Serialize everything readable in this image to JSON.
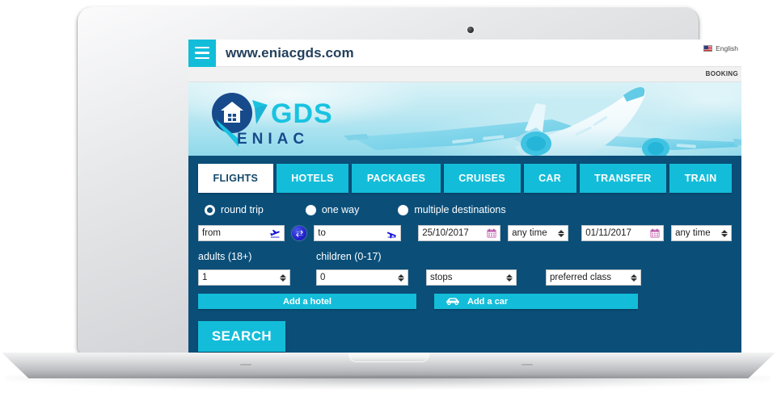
{
  "browser": {
    "menu_icon": "hamburger-icon",
    "url": "www.eniacgds.com",
    "language": "English",
    "language_flag_icon": "us-flag-icon",
    "booking_label": "BOOKING"
  },
  "hero": {
    "logo_primary": "GDS",
    "logo_secondary": "E N I A C",
    "logo_icon": "house-in-circle-icon",
    "plane_icon": "airplane-photo"
  },
  "tabs": [
    {
      "label": "FLIGHTS",
      "active": true
    },
    {
      "label": "HOTELS",
      "active": false
    },
    {
      "label": "PACKAGES",
      "active": false
    },
    {
      "label": "CRUISES",
      "active": false
    },
    {
      "label": "CAR",
      "active": false
    },
    {
      "label": "TRANSFER",
      "active": false
    },
    {
      "label": "TRAIN",
      "active": false
    }
  ],
  "trip_types": [
    {
      "label": "round trip",
      "selected": true
    },
    {
      "label": "one way",
      "selected": false
    },
    {
      "label": "multiple destinations",
      "selected": false
    }
  ],
  "search_form": {
    "origin": {
      "value": "from",
      "icon": "plane-departure-icon"
    },
    "swap": {
      "icon": "swap-arrows-icon"
    },
    "destination": {
      "value": "to",
      "icon": "plane-arrival-icon"
    },
    "depart_date": {
      "value": "25/10/2017",
      "icon": "calendar-icon"
    },
    "depart_time": {
      "value": "any time"
    },
    "return_date": {
      "value": "01/11/2017",
      "icon": "calendar-icon"
    },
    "return_time": {
      "value": "any time"
    },
    "adults_label": "adults (18+)",
    "adults_value": "1",
    "children_label": "children (0-17)",
    "children_value": "0",
    "stops": {
      "value": "stops"
    },
    "preferred_class": {
      "value": "preferred class"
    }
  },
  "addons": {
    "hotel": {
      "label": "Add a hotel"
    },
    "car": {
      "label": "Add a car",
      "icon": "car-icon"
    }
  },
  "search_button": {
    "label": "SEARCH"
  },
  "colors": {
    "accent_cyan": "#13bdd9",
    "panel_blue": "#0b4f79",
    "header_text": "#24405c",
    "swap_blue": "#2323cf",
    "field_white": "#ffffff"
  }
}
